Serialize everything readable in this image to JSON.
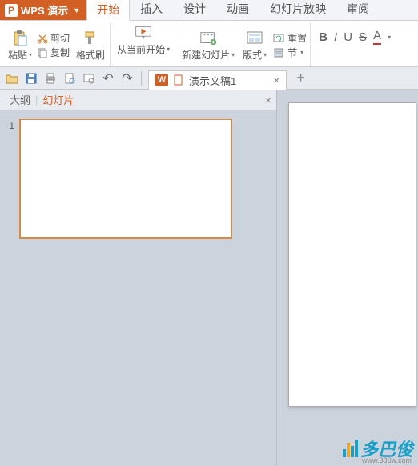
{
  "app": {
    "name": "WPS 演示"
  },
  "menuTabs": [
    "开始",
    "插入",
    "设计",
    "动画",
    "幻灯片放映",
    "审阅"
  ],
  "activeMenuTab": 0,
  "ribbon": {
    "paste": {
      "label": "粘贴"
    },
    "cut": {
      "label": "剪切"
    },
    "copy": {
      "label": "复制"
    },
    "formatPainter": {
      "label": "格式刷"
    },
    "fromCurrent": {
      "label": "从当前开始"
    },
    "newSlide": {
      "label": "新建幻灯片"
    },
    "layout": {
      "label": "版式"
    },
    "reset": {
      "label": "重置"
    },
    "section": {
      "label": "节"
    }
  },
  "docTab": {
    "title": "演示文稿1"
  },
  "sidePanel": {
    "tabs": [
      "大纲",
      "幻灯片"
    ],
    "activeTab": 1,
    "slides": [
      {
        "num": "1"
      }
    ]
  },
  "watermark": {
    "text": "多巴俊",
    "link": "www.386w.com"
  }
}
